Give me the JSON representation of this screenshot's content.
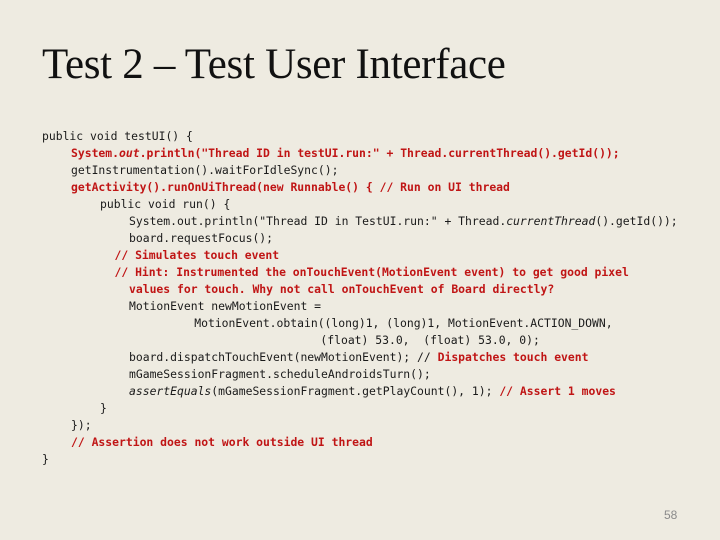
{
  "slide": {
    "title": "Test 2 – Test User Interface",
    "page_number": "58",
    "colors": {
      "background": "#eeebe1",
      "text": "#1a1a1a",
      "highlight": "#c01515",
      "page_number": "#8a8a8a"
    }
  },
  "code_lines": [
    {
      "indent": 0,
      "segments": [
        {
          "text": "public void testUI() {",
          "style": ""
        }
      ]
    },
    {
      "indent": 1,
      "segments": [
        {
          "text": "System.",
          "style": "red"
        },
        {
          "text": "out",
          "style": "red italic"
        },
        {
          "text": ".println(\"Thread ID in testUI.run:\" + Thread.currentThread().getId());",
          "style": "red"
        }
      ]
    },
    {
      "indent": 1,
      "segments": [
        {
          "text": "getInstrumentation().waitForIdleSync();",
          "style": ""
        }
      ]
    },
    {
      "indent": 1,
      "segments": [
        {
          "text": "getActivity().runOnUiThread(new Runnable() { // Run on UI thread",
          "style": "red"
        }
      ]
    },
    {
      "indent": 2,
      "segments": [
        {
          "text": "public void run() {",
          "style": ""
        }
      ]
    },
    {
      "indent": 3,
      "segments": [
        {
          "text": "System.out.println(\"Thread ID in TestUI.run:\" + Thread.",
          "style": ""
        },
        {
          "text": "currentThread",
          "style": "italic"
        },
        {
          "text": "().getId());",
          "style": ""
        }
      ]
    },
    {
      "indent": 3,
      "segments": [
        {
          "text": "board.requestFocus();",
          "style": ""
        }
      ]
    },
    {
      "indent": 2.5,
      "segments": [
        {
          "text": "// Simulates touch event",
          "style": "red"
        }
      ]
    },
    {
      "indent": 2.5,
      "segments": [
        {
          "text": "// Hint: Instrumented the onTouchEvent(MotionEvent event) to get good pixel",
          "style": "red"
        }
      ]
    },
    {
      "indent": 3,
      "segments": [
        {
          "text": "values for touch. Why not call onTouchEvent of Board directly?",
          "style": "red"
        }
      ]
    },
    {
      "indent": 3,
      "segments": [
        {
          "text": "MotionEvent newMotionEvent =",
          "style": ""
        }
      ]
    },
    {
      "indent": 5.25,
      "segments": [
        {
          "text": "MotionEvent.obtain((long)1, (long)1, MotionEvent.ACTION_DOWN,",
          "style": ""
        }
      ]
    },
    {
      "indent": 9.6,
      "segments": [
        {
          "text": "(float) 53.0,  (float) 53.0, 0);",
          "style": ""
        }
      ]
    },
    {
      "indent": 3,
      "segments": [
        {
          "text": "board.dispatchTouchEvent(newMotionEvent); // ",
          "style": ""
        },
        {
          "text": "Dispatches touch event",
          "style": "red"
        }
      ]
    },
    {
      "indent": 3,
      "segments": [
        {
          "text": "mGameSessionFragment.scheduleAndroidsTurn();",
          "style": ""
        }
      ]
    },
    {
      "indent": 3,
      "segments": [
        {
          "text": "assertEquals",
          "style": "italic"
        },
        {
          "text": "(mGameSessionFragment.getPlayCount(), 1); ",
          "style": ""
        },
        {
          "text": "// Assert 1 moves",
          "style": "red"
        }
      ]
    },
    {
      "indent": 2,
      "segments": [
        {
          "text": "}",
          "style": ""
        }
      ]
    },
    {
      "indent": 1,
      "segments": [
        {
          "text": "});",
          "style": ""
        }
      ]
    },
    {
      "indent": 1,
      "segments": [
        {
          "text": "// Assertion does not work outside UI thread",
          "style": "red"
        }
      ]
    },
    {
      "indent": 0,
      "segments": [
        {
          "text": "}",
          "style": ""
        }
      ]
    }
  ]
}
